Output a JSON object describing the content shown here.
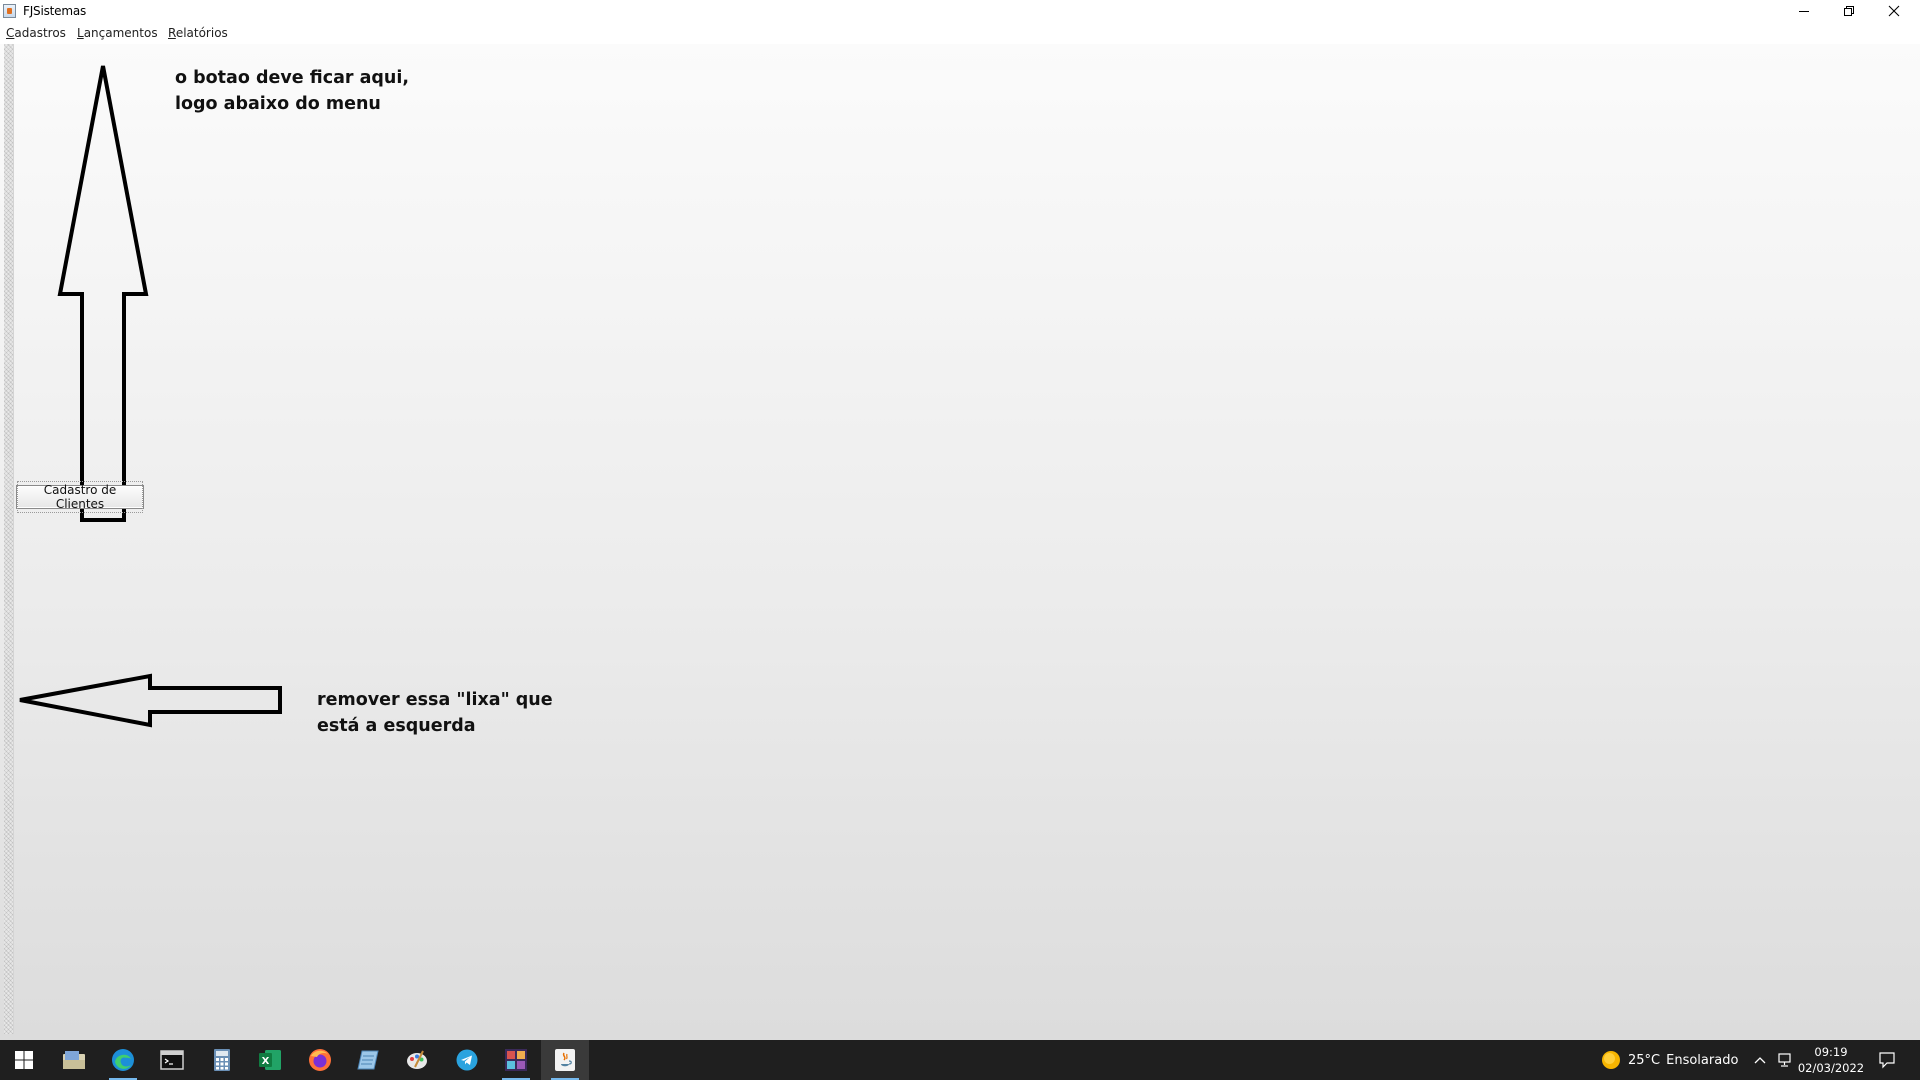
{
  "window": {
    "title": "FJSistemas"
  },
  "menu": {
    "items": [
      {
        "mnemonic": "C",
        "rest": "adastros"
      },
      {
        "mnemonic": "L",
        "rest": "ançamentos"
      },
      {
        "mnemonic": "R",
        "rest": "elatórios"
      }
    ]
  },
  "main": {
    "button_label": "Cadastro de Clientes",
    "annotation_top": {
      "line1": "o botao deve ficar aqui,",
      "line2": "logo abaixo do menu"
    },
    "annotation_bottom": {
      "line1": "remover essa \"lixa\" que",
      "line2": "está a esquerda"
    }
  },
  "taskbar": {
    "apps": [
      "windows-start-icon",
      "file-explorer-icon",
      "edge-browser-icon",
      "terminal-icon",
      "calculator-icon",
      "excel-icon",
      "firefox-icon",
      "notepad-icon",
      "paint-icon",
      "telegram-icon",
      "ide-icon",
      "java-app-icon"
    ],
    "weather": {
      "temperature": "25°C",
      "condition": "Ensolarado"
    },
    "clock": {
      "time": "09:19",
      "date": "02/03/2022"
    }
  },
  "colors": {
    "taskbar_bg": "#1f1f1f",
    "accent": "#76b9ed"
  }
}
